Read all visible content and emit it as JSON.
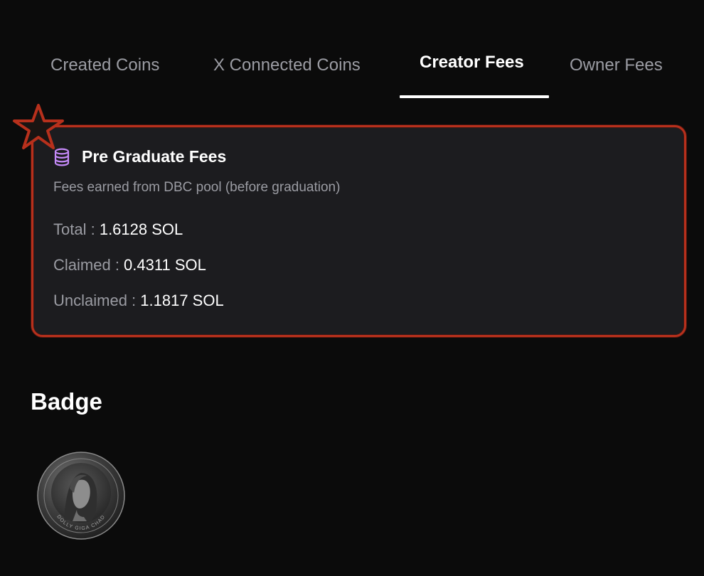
{
  "tabs": [
    {
      "label": "Created Coins",
      "active": false
    },
    {
      "label": "X Connected Coins",
      "active": false
    },
    {
      "label": "Creator Fees",
      "active": true
    },
    {
      "label": "Owner Fees",
      "active": false
    }
  ],
  "card": {
    "icon": "database-icon",
    "title": "Pre Graduate Fees",
    "subtitle": "Fees earned from DBC pool (before graduation)",
    "rows": [
      {
        "label": "Total",
        "sep": " : ",
        "value": "1.6128 SOL"
      },
      {
        "label": "Claimed",
        "sep": " : ",
        "value": "0.4311 SOL"
      },
      {
        "label": "Unclaimed",
        "sep": " : ",
        "value": "1.1817 SOL"
      }
    ]
  },
  "badge": {
    "heading": "Badge",
    "coin_caption": "DOLLY GIGA CHAD"
  },
  "colors": {
    "background": "#0b0b0b",
    "card": "#1c1c1f",
    "highlight": "#b7301c",
    "muted_text": "#9b9ca3",
    "icon_accent": "#c58af9"
  }
}
